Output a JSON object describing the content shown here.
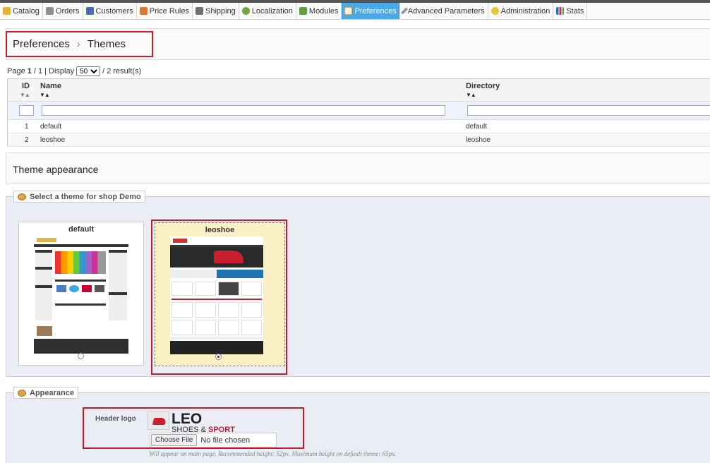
{
  "nav": {
    "tabs": [
      {
        "label": "Catalog",
        "icon": "folder-icon",
        "color": "#e6b33a"
      },
      {
        "label": "Orders",
        "icon": "cart-icon",
        "color": "#8e8e8e"
      },
      {
        "label": "Customers",
        "icon": "user-icon",
        "color": "#4d6ea8"
      },
      {
        "label": "Price Rules",
        "icon": "price-icon",
        "color": "#d37a3d"
      },
      {
        "label": "Shipping",
        "icon": "truck-icon",
        "color": "#6f6f6f"
      },
      {
        "label": "Localization",
        "icon": "globe-icon",
        "color": "#6ca843"
      },
      {
        "label": "Modules",
        "icon": "puzzle-icon",
        "color": "#5fa040"
      },
      {
        "label": "Preferences",
        "icon": "preferences-icon",
        "color": "#f2f2f2"
      },
      {
        "label": "Advanced Parameters",
        "icon": "wrench-icon",
        "color": "#9a9a9a"
      },
      {
        "label": "Administration",
        "icon": "key-icon",
        "color": "#e8c53b"
      },
      {
        "label": "Stats",
        "icon": "chart-icon",
        "color": "#3a68b9"
      }
    ],
    "active": "Preferences"
  },
  "breadcrumb": {
    "parent": "Preferences",
    "separator": "›",
    "current": "Themes"
  },
  "pager": {
    "page_prefix": "Page",
    "page": "1",
    "pages": "/ 1 | Display",
    "per_page": "50",
    "results": "/ 2 result(s)"
  },
  "table": {
    "headers": {
      "id": "ID",
      "name": "Name",
      "directory": "Directory"
    },
    "sort_glyph": "▼▲",
    "rows": [
      {
        "id": "1",
        "name": "default",
        "directory": "default"
      },
      {
        "id": "2",
        "name": "leoshoe",
        "directory": "leoshoe"
      }
    ]
  },
  "theme_appearance": {
    "title": "Theme appearance",
    "legend": "Select a theme for shop Demo",
    "themes": [
      {
        "name": "default",
        "selected": false
      },
      {
        "name": "leoshoe",
        "selected": true
      }
    ]
  },
  "appearance": {
    "legend": "Appearance",
    "header_logo_label": "Header logo",
    "logo_big": "LEO",
    "logo_small": "SHOES",
    "logo_amp": "&",
    "logo_sport": "SPORT",
    "choose_file": "Choose File",
    "no_file": "No file chosen",
    "hint": "Will appear on main page. Recommended height: 52px. Maximum height on default theme: 65px."
  },
  "colors": {
    "active_tab": "#49a8e5",
    "highlight": "#d01a2a",
    "selected_card": "#fbefc4"
  }
}
